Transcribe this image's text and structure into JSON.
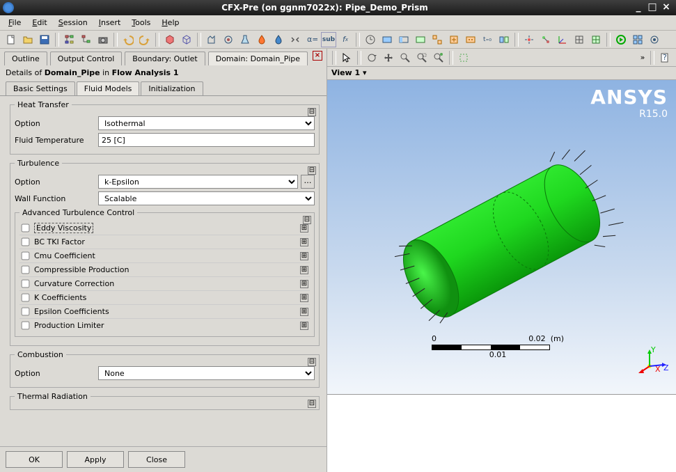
{
  "window": {
    "title": "CFX-Pre (on ggnm7022x):  Pipe_Demo_Prism"
  },
  "menubar": [
    "File",
    "Edit",
    "Session",
    "Insert",
    "Tools",
    "Help"
  ],
  "outer_tabs": {
    "items": [
      "Outline",
      "Output Control",
      "Boundary: Outlet",
      "Domain: Domain_Pipe"
    ],
    "active_index": 3
  },
  "details_label_parts": {
    "prefix": "Details of ",
    "domain": "Domain_Pipe",
    "mid": " in ",
    "analysis": "Flow Analysis 1"
  },
  "inner_tabs": {
    "items": [
      "Basic Settings",
      "Fluid Models",
      "Initialization"
    ],
    "active_index": 1
  },
  "heat_transfer": {
    "legend": "Heat Transfer",
    "option_label": "Option",
    "option_value": "Isothermal",
    "temp_label": "Fluid Temperature",
    "temp_value": "25 [C]"
  },
  "turbulence": {
    "legend": "Turbulence",
    "option_label": "Option",
    "option_value": "k-Epsilon",
    "wall_label": "Wall Function",
    "wall_value": "Scalable",
    "advanced_legend": "Advanced Turbulence Control",
    "advanced_items": [
      "Eddy Viscosity",
      "BC TKI Factor",
      "Cmu Coefficient",
      "Compressible Production",
      "Curvature Correction",
      "K Coefficients",
      "Epsilon Coefficients",
      "Production Limiter"
    ]
  },
  "combustion": {
    "legend": "Combustion",
    "option_label": "Option",
    "option_value": "None"
  },
  "thermal_radiation": {
    "legend": "Thermal Radiation"
  },
  "buttons": {
    "ok": "OK",
    "apply": "Apply",
    "close": "Close"
  },
  "view": {
    "label": "View 1 ▾",
    "brand": "ANSYS",
    "version": "R15.0",
    "scale": {
      "left": "0",
      "right": "0.02",
      "unit": "(m)",
      "mid": "0.01"
    },
    "triad": {
      "x": "X",
      "y": "Y",
      "z": "Z"
    }
  }
}
